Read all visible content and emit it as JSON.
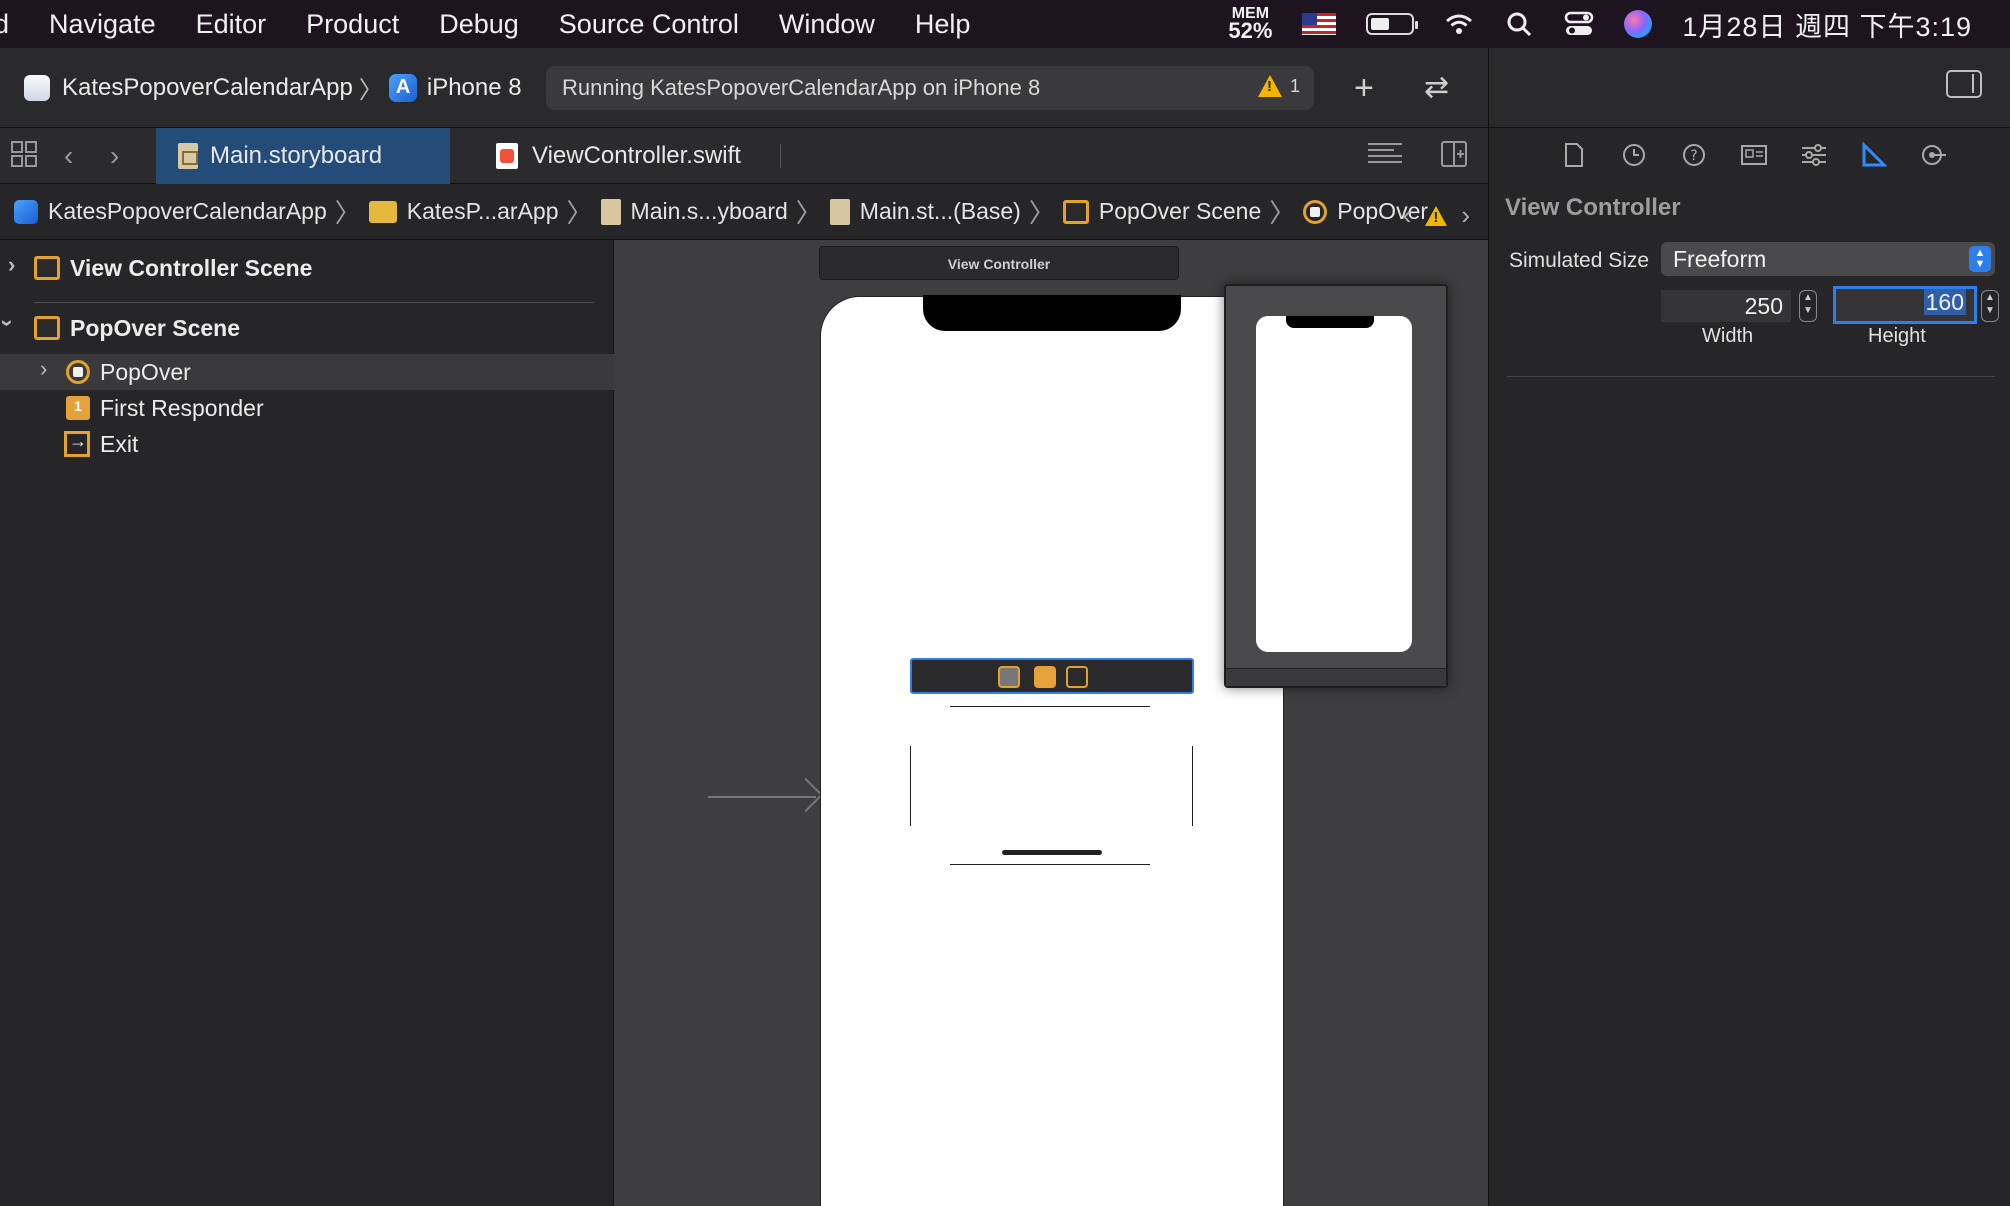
{
  "menubar": {
    "items": [
      "d",
      "Navigate",
      "Editor",
      "Product",
      "Debug",
      "Source Control",
      "Window",
      "Help"
    ],
    "mem_label": "MEM",
    "mem_value": "52%",
    "clock": "1月28日 週四 下午3:19"
  },
  "toolbar": {
    "app_name": "KatesPopoverCalendarApp",
    "device": "iPhone 8",
    "activity": "Running KatesPopoverCalendarApp on iPhone 8",
    "warning_count": "1"
  },
  "tabs": [
    {
      "label": "Main.storyboard",
      "active": true
    },
    {
      "label": "ViewController.swift",
      "active": false
    }
  ],
  "jumpbar": {
    "items": [
      "KatesPopoverCalendarApp",
      "KatesP...arApp",
      "Main.s...yboard",
      "Main.st...(Base)",
      "PopOver Scene",
      "PopOver"
    ]
  },
  "navigator": {
    "scene1": "View Controller Scene",
    "scene2": "PopOver Scene",
    "children": [
      "PopOver",
      "First Responder",
      "Exit"
    ]
  },
  "canvas": {
    "vc_label": "View Controller"
  },
  "inspector": {
    "title": "View Controller",
    "simulated_size_label": "Simulated Size",
    "simulated_size_value": "Freeform",
    "width_value": "250",
    "height_value": "160",
    "width_caption": "Width",
    "height_caption": "Height"
  },
  "colors": {
    "accent": "#2f7fe8",
    "selected_tab": "#244c78",
    "warning": "#f2b500"
  }
}
